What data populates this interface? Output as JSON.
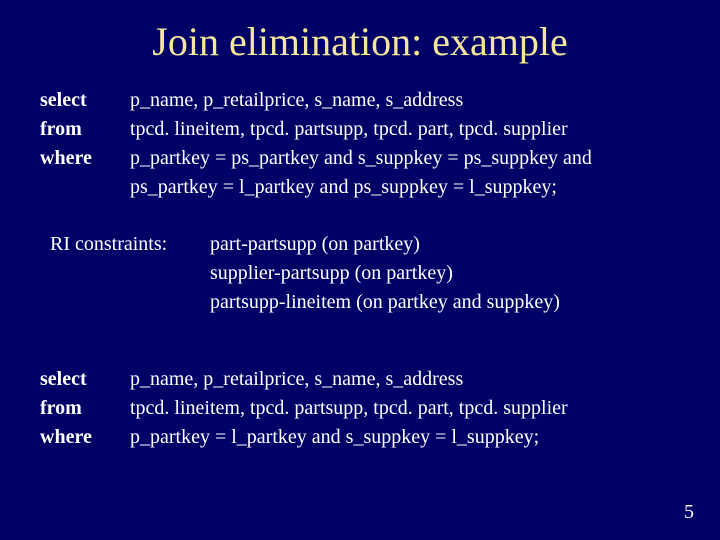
{
  "title": "Join elimination: example",
  "sql1": {
    "kw_select": "select",
    "kw_from": "from",
    "kw_where": "where",
    "line_select": "p_name, p_retailprice, s_name, s_address",
    "line_from": "tpcd. lineitem, tpcd. partsupp, tpcd. part, tpcd. supplier",
    "line_where1": "p_partkey = ps_partkey and s_suppkey = ps_suppkey and",
    "line_where2": "ps_partkey = l_partkey and ps_suppkey = l_suppkey;"
  },
  "ri": {
    "label": "RI constraints:",
    "item1": "part-partsupp (on partkey)",
    "item2": "supplier-partsupp (on partkey)",
    "item3": "partsupp-lineitem (on partkey and suppkey)"
  },
  "sql2": {
    "kw_select": "select",
    "kw_from": "from",
    "kw_where": "where",
    "line_select": "p_name, p_retailprice, s_name, s_address",
    "line_from": "tpcd. lineitem, tpcd. partsupp, tpcd. part, tpcd. supplier",
    "line_where": "p_partkey = l_partkey and s_suppkey = l_suppkey;"
  },
  "page_number": "5"
}
